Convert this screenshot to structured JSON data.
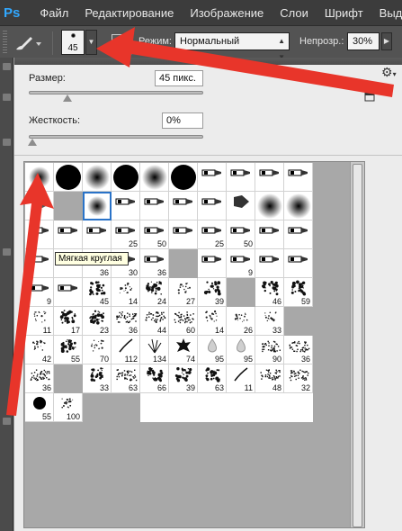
{
  "app": {
    "logo": "Ps"
  },
  "menu": [
    "Файл",
    "Редактирование",
    "Изображение",
    "Слои",
    "Шрифт",
    "Выделе"
  ],
  "options_bar": {
    "brush_size_preview": "45",
    "mode_label": "Режим:",
    "mode_value": "Нормальный",
    "opacity_label": "Непрозр.:",
    "opacity_value": "30%"
  },
  "brush_panel": {
    "size_label": "Размер:",
    "size_value": "45 пикс.",
    "size_fraction": 0.22,
    "hardness_label": "Жесткость:",
    "hardness_value": "0%",
    "hardness_fraction": 0.0,
    "tooltip": "Мягкая круглая",
    "rows": [
      [
        {
          "k": "soft-sm"
        },
        {
          "k": "hard-lg"
        },
        {
          "k": "soft-lg"
        },
        {
          "k": "hard-lg"
        },
        {
          "k": "soft-lg"
        },
        {
          "k": "hard-lg"
        },
        {
          "k": "tip"
        },
        {
          "k": "tip"
        },
        {
          "k": "tip"
        },
        {
          "k": "tip"
        },
        {
          "k": "fan"
        }
      ],
      [
        {
          "k": "soft-sel"
        },
        {
          "k": "tip"
        },
        {
          "k": "tip"
        },
        {
          "k": "tip"
        },
        {
          "k": "tip"
        },
        {
          "k": "wedge"
        },
        {
          "k": "soft-lg"
        },
        {
          "k": "soft-lg"
        },
        {
          "k": "tip"
        },
        {
          "k": "tip"
        },
        {
          "k": "tip"
        },
        {
          "k": "tip",
          "n": "25"
        }
      ],
      [
        {
          "k": "tip",
          "n": "50"
        },
        {
          "k": "tip"
        },
        {
          "k": "tip",
          "n": "25"
        },
        {
          "k": "tip",
          "n": "50"
        },
        {
          "k": "tip"
        },
        {
          "k": "tip"
        },
        {
          "k": "tip"
        },
        {
          "k": "tip"
        },
        {
          "k": "tip",
          "n": "36"
        },
        {
          "k": "tip",
          "n": "30"
        },
        {
          "k": "tip",
          "n": "36"
        }
      ],
      [
        {
          "k": "tip",
          "n": ""
        },
        {
          "k": "tip",
          "n": "9"
        },
        {
          "k": "tip"
        },
        {
          "k": "tip"
        },
        {
          "k": "tip",
          "n": "9"
        },
        {
          "k": "tip"
        },
        {
          "k": "splat",
          "n": "45"
        },
        {
          "k": "scatter",
          "n": "14"
        },
        {
          "k": "splat",
          "n": "24"
        },
        {
          "k": "scatter",
          "n": "27"
        },
        {
          "k": "splat",
          "n": "39"
        }
      ],
      [
        {
          "k": "splat",
          "n": "46"
        },
        {
          "k": "splat",
          "n": "59"
        },
        {
          "k": "scatter",
          "n": "11"
        },
        {
          "k": "splat",
          "n": "17"
        },
        {
          "k": "splat",
          "n": "23"
        },
        {
          "k": "texture",
          "n": "36"
        },
        {
          "k": "texture",
          "n": "44"
        },
        {
          "k": "texture",
          "n": "60"
        },
        {
          "k": "scatter",
          "n": "14"
        },
        {
          "k": "scatter",
          "n": "26"
        },
        {
          "k": "scatter",
          "n": "33"
        }
      ],
      [
        {
          "k": "scatter",
          "n": "42"
        },
        {
          "k": "splat",
          "n": "55"
        },
        {
          "k": "scatter",
          "n": "70"
        },
        {
          "k": "stroke",
          "n": "112"
        },
        {
          "k": "grass",
          "n": "134"
        },
        {
          "k": "leaf",
          "n": "74"
        },
        {
          "k": "drop",
          "n": "95"
        },
        {
          "k": "drop",
          "n": "95"
        },
        {
          "k": "texture",
          "n": "90"
        },
        {
          "k": "texture",
          "n": "36"
        },
        {
          "k": "texture",
          "n": "36"
        }
      ],
      [
        {
          "k": "splat",
          "n": "33"
        },
        {
          "k": "texture",
          "n": "63"
        },
        {
          "k": "splat",
          "n": "66"
        },
        {
          "k": "splat",
          "n": "39"
        },
        {
          "k": "splat",
          "n": "63"
        },
        {
          "k": "stroke",
          "n": "11"
        },
        {
          "k": "texture",
          "n": "48"
        },
        {
          "k": "texture",
          "n": "32"
        },
        {
          "k": "hard-md",
          "n": "55"
        },
        {
          "k": "scatter",
          "n": "100"
        }
      ]
    ]
  }
}
